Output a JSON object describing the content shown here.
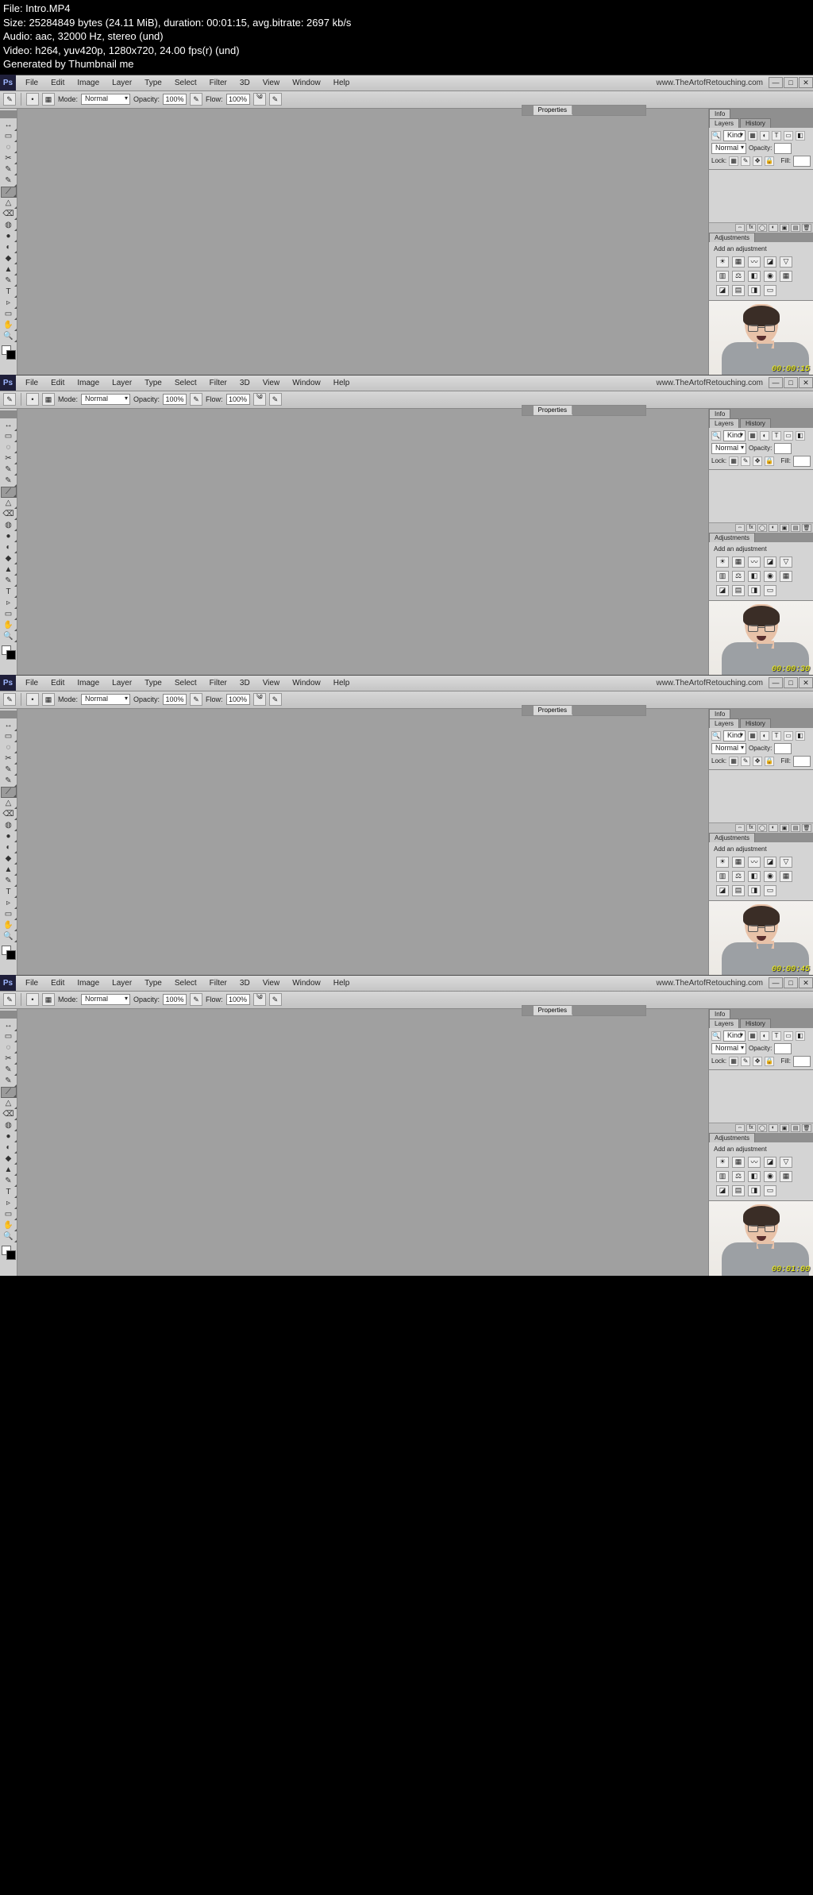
{
  "header": {
    "line1": "File: Intro.MP4",
    "line2": "Size: 25284849 bytes (24.11 MiB), duration: 00:01:15, avg.bitrate: 2697 kb/s",
    "line3": "Audio: aac, 32000 Hz, stereo (und)",
    "line4": "Video: h264, yuv420p, 1280x720, 24.00 fps(r) (und)",
    "line5": "Generated by Thumbnail me"
  },
  "menu": {
    "items": [
      "File",
      "Edit",
      "Image",
      "Layer",
      "Type",
      "Select",
      "Filter",
      "3D",
      "View",
      "Window",
      "Help"
    ],
    "url": "www.TheArtofRetouching.com"
  },
  "opt": {
    "mode_label": "Mode:",
    "mode_value": "Normal",
    "opacity_label": "Opacity:",
    "opacity_value": "100%",
    "flow_label": "Flow:",
    "flow_value": "100%",
    "props_tab": "Properties",
    "info_tab": "Info"
  },
  "layers": {
    "tab1": "Layers",
    "tab2": "History",
    "kind": "Kind",
    "blend": "Normal",
    "opacity_l": "Opacity:",
    "lock_l": "Lock:",
    "fill_l": "Fill:"
  },
  "adjust": {
    "tab": "Adjustments",
    "hint": "Add an adjustment"
  },
  "timestamps": [
    "00:00:15",
    "00:00:30",
    "00:00:45",
    "00:01:00"
  ],
  "tool_glyphs": [
    "↔",
    "▭",
    "◌",
    "✂",
    "✎",
    "✎",
    "⟋",
    "△",
    "⌫",
    "◍",
    "●",
    "◐",
    "◆",
    "▲",
    "✎",
    "T",
    "▹",
    "▭",
    "✋",
    "🔍"
  ]
}
